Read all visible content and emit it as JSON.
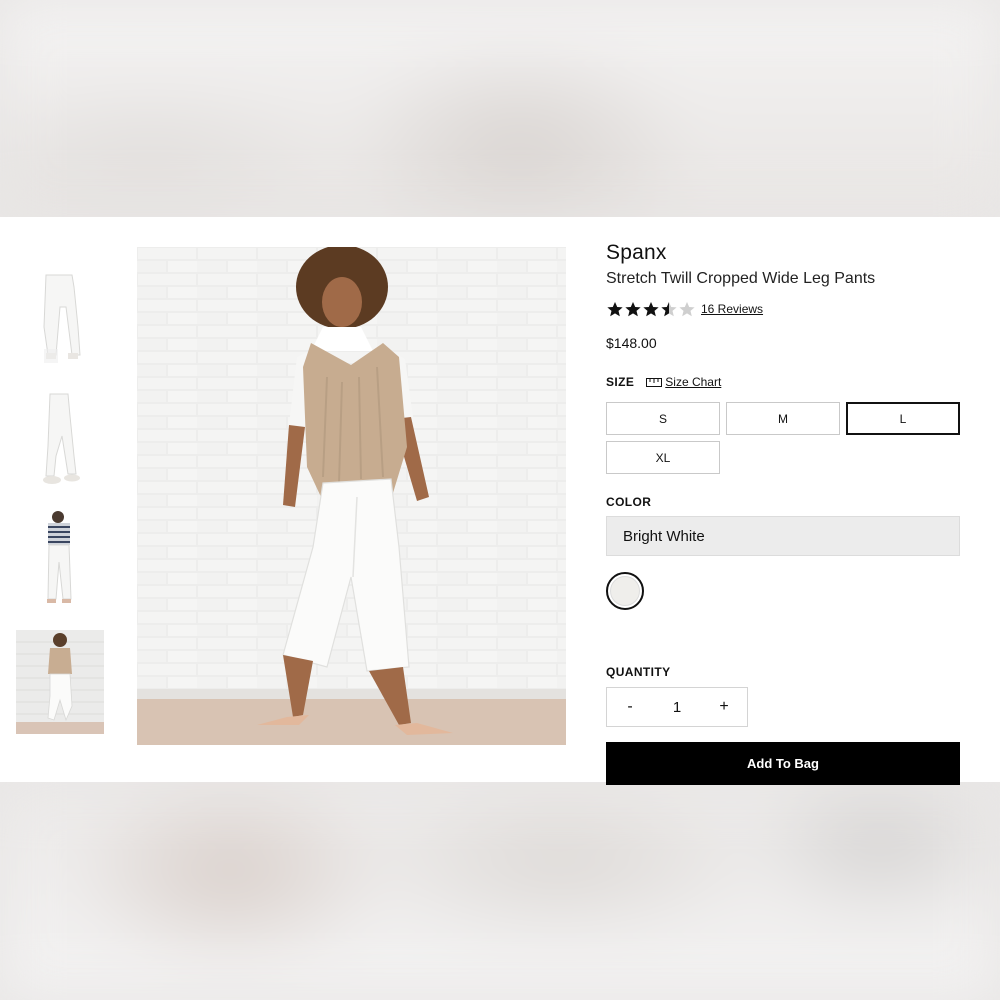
{
  "product": {
    "brand": "Spanx",
    "name": "Stretch Twill Cropped Wide Leg Pants",
    "rating": 3.5,
    "rating_max": 5,
    "reviews_label": "16 Reviews",
    "price": "$148.00"
  },
  "size": {
    "label": "SIZE",
    "chart_label": "Size Chart",
    "options": [
      "S",
      "M",
      "L",
      "XL"
    ],
    "selected": "L"
  },
  "color": {
    "label": "COLOR",
    "selected_name": "Bright White",
    "swatch_hex": "#efeeeb"
  },
  "quantity": {
    "label": "QUANTITY",
    "value": "1",
    "decrement": "-",
    "increment": "+"
  },
  "cta": {
    "add_to_bag": "Add To Bag"
  },
  "gallery": {
    "thumbnail_count": 4,
    "active_index": 3
  },
  "colors": {
    "accent": "#000000",
    "star": "#111111",
    "star_empty": "#cfcfcf"
  }
}
